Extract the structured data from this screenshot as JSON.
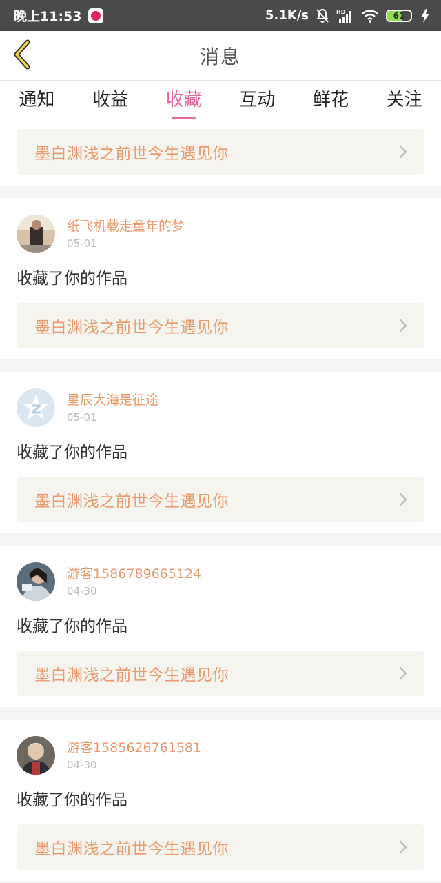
{
  "status_bar": {
    "time": "晚上11:53",
    "net_speed": "5.1K/s",
    "battery_level": "61",
    "battery_fraction": 0.61
  },
  "header": {
    "title": "消息",
    "back_icon": "chevron-left-icon"
  },
  "tabs": [
    {
      "label": "通知",
      "active": false
    },
    {
      "label": "收益",
      "active": false
    },
    {
      "label": "收藏",
      "active": true
    },
    {
      "label": "互动",
      "active": false
    },
    {
      "label": "鲜花",
      "active": false
    },
    {
      "label": "关注",
      "active": false
    }
  ],
  "first_card": {
    "work_title": "墨白渊浅之前世今生遇见你"
  },
  "items": [
    {
      "user": "纸飞机载走童年的梦",
      "date": "05-01",
      "action": "收藏了你的作品",
      "work_title": "墨白渊浅之前世今生遇见你"
    },
    {
      "user": "星辰大海是征途",
      "date": "05-01",
      "action": "收藏了你的作品",
      "work_title": "墨白渊浅之前世今生遇见你"
    },
    {
      "user": "游客1586789665124",
      "date": "04-30",
      "action": "收藏了你的作品",
      "work_title": "墨白渊浅之前世今生遇见你"
    },
    {
      "user": "游客1585626761581",
      "date": "04-30",
      "action": "收藏了你的作品",
      "work_title": "墨白渊浅之前世今生遇见你"
    }
  ],
  "colors": {
    "accent": "#e4679d",
    "username": "#ea9a6c",
    "link_bg": "#f5f4ee",
    "status_bar": "#4a4a4a"
  }
}
